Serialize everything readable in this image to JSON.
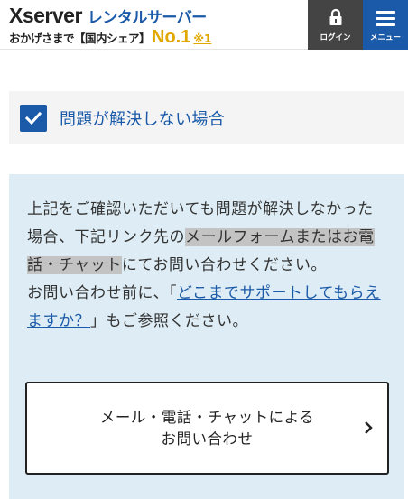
{
  "header": {
    "logo": "Xserver",
    "subtitle": "レンタルサーバー",
    "tagline": "おかげさまで【国内シェア】",
    "no1": "No.1",
    "note": "※1",
    "login_label": "ログイン",
    "menu_label": "メニュー"
  },
  "resolve": {
    "label": "問題が解決しない場合",
    "checked": true
  },
  "info": {
    "text_before_highlight": "上記をご確認いただいても問題が解決しなかった場合、下記リンク先の",
    "highlight": "メールフォームまたはお電話・チャット",
    "text_after_highlight": "にてお問い合わせください。",
    "prefix_before_link": "お問い合わせ前に、「",
    "link_text": "どこまでサポートしてもらえますか？",
    "suffix_after_link": "」もご参照ください。"
  },
  "contact_button": {
    "line1": "メール・電話・チャットによる",
    "line2": "お問い合わせ"
  },
  "colors": {
    "brand_blue": "#1a5aa8",
    "gold": "#e0a800",
    "panel_bg": "#deedf5",
    "login_bg": "#444444"
  }
}
